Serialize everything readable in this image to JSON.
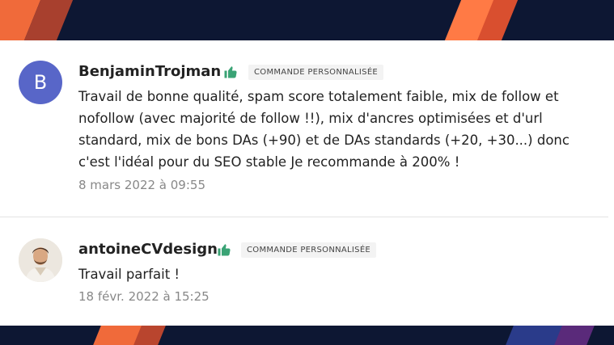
{
  "reviews": [
    {
      "username": "BenjaminTrojman",
      "avatar_initial": "B",
      "badge": "COMMANDE PERSONNALISÉE",
      "lines": [
        "Travail de bonne qualité, spam score totalement faible, mix de follow et",
        "nofollow (avec majorité de follow !!), mix d'ancres optimisées et d'url",
        "standard, mix de bons DAs (+90) et de DAs standards (+20, +30...) donc",
        "c'est l'idéal pour du SEO stable Je recommande à 200% !"
      ],
      "date": "8 mars 2022 à 09:55"
    },
    {
      "username": "antoineCVdesign",
      "badge": "COMMANDE PERSONNALISÉE",
      "lines": [
        "Travail parfait !"
      ],
      "date": "18 févr. 2022 à 15:25"
    }
  ],
  "colors": {
    "thumb": "#3aa375",
    "avatar_bg": "#5866c8"
  },
  "icons": {
    "thumb": "thumbs-up-icon"
  }
}
